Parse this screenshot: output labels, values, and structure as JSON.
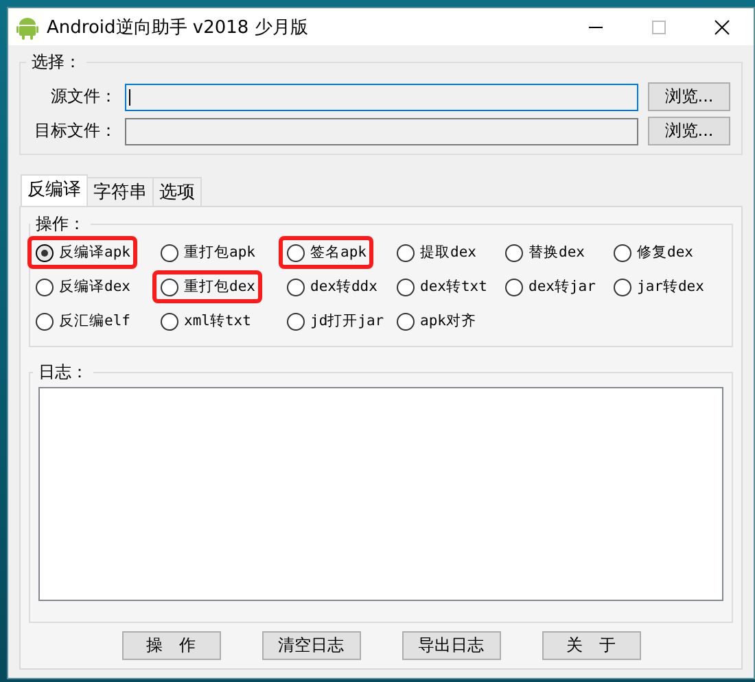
{
  "window": {
    "title": "Android逆向助手 v2018 少月版"
  },
  "select_group": {
    "label": "选择：",
    "fields": [
      {
        "label": "源文件：",
        "focused": true,
        "browse": "浏览..."
      },
      {
        "label": "目标文件：",
        "focused": false,
        "browse": "浏览..."
      }
    ]
  },
  "tabs": [
    {
      "label": "反编译",
      "selected": true
    },
    {
      "label": "字符串",
      "selected": false
    },
    {
      "label": "选项",
      "selected": false
    }
  ],
  "operations": {
    "label": "操作：",
    "options": [
      {
        "label": "反编译apk",
        "selected": true,
        "highlighted": true
      },
      {
        "label": "重打包apk",
        "selected": false,
        "highlighted": false
      },
      {
        "label": "签名apk",
        "selected": false,
        "highlighted": true
      },
      {
        "label": "提取dex",
        "selected": false,
        "highlighted": false
      },
      {
        "label": "替换dex",
        "selected": false,
        "highlighted": false
      },
      {
        "label": "修复dex",
        "selected": false,
        "highlighted": false
      },
      {
        "label": "反编译dex",
        "selected": false,
        "highlighted": false
      },
      {
        "label": "重打包dex",
        "selected": false,
        "highlighted": true
      },
      {
        "label": "dex转ddx",
        "selected": false,
        "highlighted": false
      },
      {
        "label": "dex转txt",
        "selected": false,
        "highlighted": false
      },
      {
        "label": "dex转jar",
        "selected": false,
        "highlighted": false
      },
      {
        "label": "jar转dex",
        "selected": false,
        "highlighted": false
      },
      {
        "label": "反汇编elf",
        "selected": false,
        "highlighted": false
      },
      {
        "label": "xml转txt",
        "selected": false,
        "highlighted": false
      },
      {
        "label": "jd打开jar",
        "selected": false,
        "highlighted": false
      },
      {
        "label": "apk对齐",
        "selected": false,
        "highlighted": false
      }
    ]
  },
  "log": {
    "label": "日志："
  },
  "buttons": [
    "操　作",
    "清空日志",
    "导出日志",
    "关　于"
  ]
}
